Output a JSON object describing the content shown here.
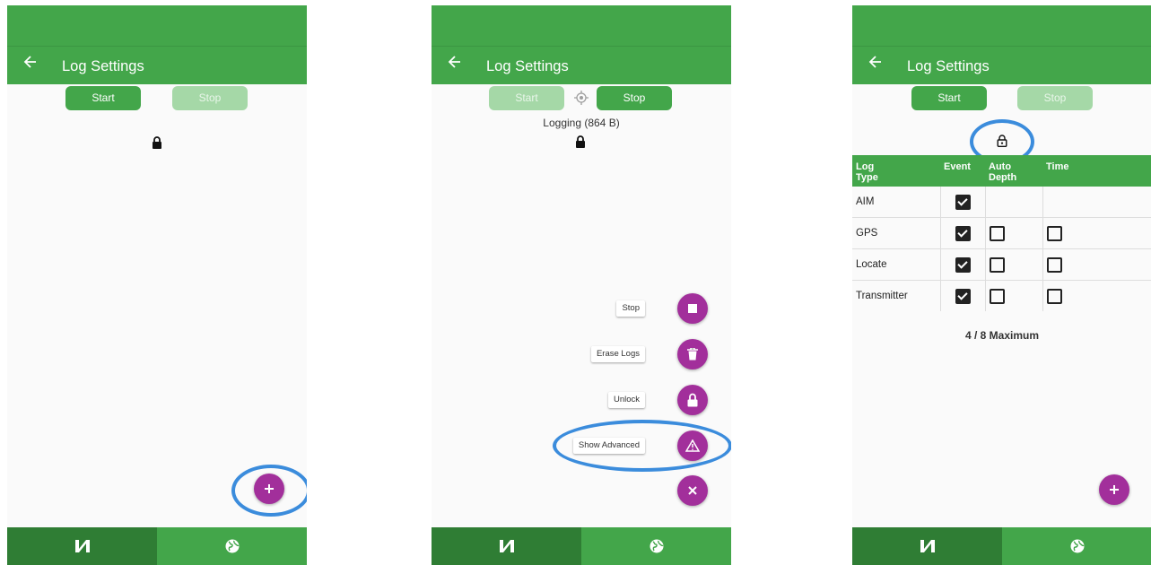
{
  "screens": [
    {
      "title": "Log Settings",
      "start_label": "Start",
      "stop_label": "Stop"
    },
    {
      "title": "Log Settings",
      "start_label": "Start",
      "stop_label": "Stop",
      "status": "Logging (864 B)",
      "fab_actions": [
        {
          "label": "Stop",
          "icon": "stop-icon"
        },
        {
          "label": "Erase Logs",
          "icon": "trash-icon"
        },
        {
          "label": "Unlock",
          "icon": "lock-icon"
        },
        {
          "label": "Show Advanced",
          "icon": "warning-icon"
        }
      ]
    },
    {
      "title": "Log Settings",
      "start_label": "Start",
      "stop_label": "Stop",
      "table": {
        "headers": [
          "Log Type",
          "Event",
          "Auto Depth",
          "Time"
        ],
        "rows": [
          {
            "type": "AIM",
            "event": true,
            "auto_depth": null,
            "time": null
          },
          {
            "type": "GPS",
            "event": true,
            "auto_depth": false,
            "time": false
          },
          {
            "type": "Locate",
            "event": true,
            "auto_depth": false,
            "time": false
          },
          {
            "type": "Transmitter",
            "event": true,
            "auto_depth": false,
            "time": false
          }
        ]
      },
      "max_text": "4 / 8 Maximum"
    }
  ],
  "colors": {
    "primary": "#43a64a",
    "primary_dark": "#2f7d34",
    "accent": "#a22f9b",
    "highlight": "#3b8cdc"
  }
}
